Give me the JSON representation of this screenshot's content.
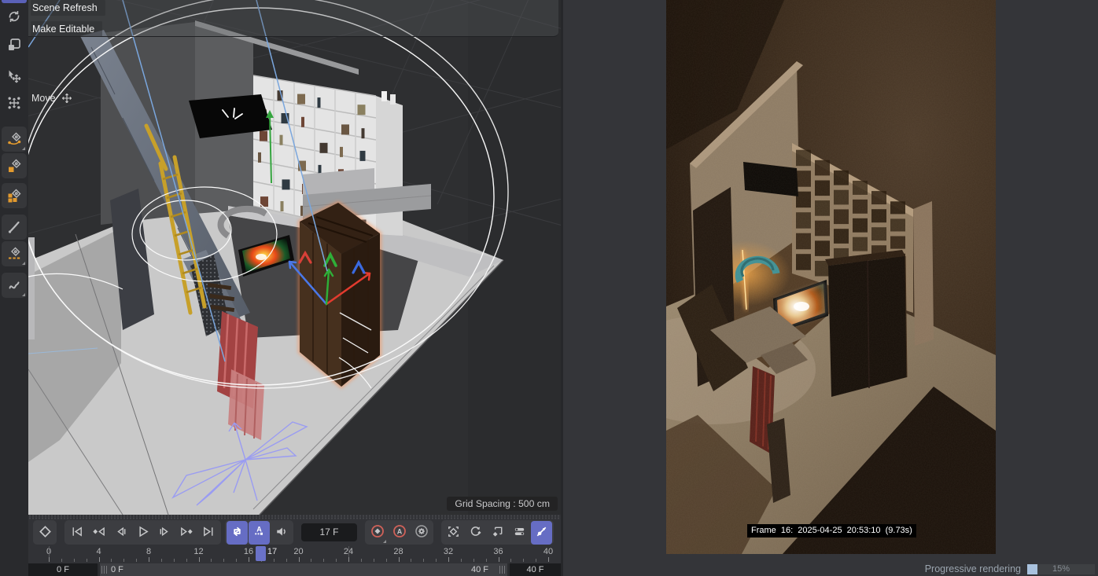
{
  "context_menu": {
    "items": [
      {
        "label": "Scene Refresh"
      },
      {
        "label": "Make Editable"
      }
    ]
  },
  "viewport": {
    "tool_label": "Move",
    "grid_spacing_label": "Grid Spacing : 500 cm"
  },
  "left_toolbar": {
    "icons": [
      "refresh-icon",
      "make-editable-icon",
      "move-tool-icon",
      "transform-tool-icon",
      "spline-pen-icon",
      "spline-square-pen-icon",
      "spline-cubes-icon",
      "brush-icon",
      "spline-dash-pen-icon",
      "freehand-spline-icon"
    ]
  },
  "timeline": {
    "current_frame_label": "17 F",
    "playhead_frame": 17,
    "playhead_label": "17",
    "frame_start": 0,
    "frame_end": 40,
    "ruler_labels": [
      {
        "frame": 0,
        "label": "0"
      },
      {
        "frame": 4,
        "label": "4"
      },
      {
        "frame": 8,
        "label": "8"
      },
      {
        "frame": 12,
        "label": "12"
      },
      {
        "frame": 16,
        "label": "16"
      },
      {
        "frame": 20,
        "label": "20"
      },
      {
        "frame": 24,
        "label": "24"
      },
      {
        "frame": 28,
        "label": "28"
      },
      {
        "frame": 32,
        "label": "32"
      },
      {
        "frame": 36,
        "label": "36"
      },
      {
        "frame": 40,
        "label": "40"
      }
    ],
    "guide_frames": [
      0,
      24
    ],
    "range_start_value": "0 F",
    "range_end_value": "40 F",
    "slider_start_label": "0 F",
    "slider_end_label": "40 F",
    "transport_icons": [
      "keyframe-diamond-icon",
      "go-start-icon",
      "prev-key-icon",
      "prev-frame-icon",
      "play-icon",
      "next-frame-icon",
      "next-key-icon",
      "go-end-icon",
      "loop-mode-icon",
      "keyframe-a-mode-icon",
      "sound-icon",
      "record-keyframe-icon",
      "autokey-icon",
      "keying-settings-icon",
      "record-position-icon",
      "record-rotation-icon",
      "record-scale-icon",
      "record-parameter-icon",
      "record-pla-icon"
    ],
    "active_toggles": [
      "loop-mode",
      "keyframe-a-mode",
      "record-pla"
    ]
  },
  "render_view": {
    "frame_info": "Frame  16:  2025-04-25  20:53:10  (9.73s)"
  },
  "status_bar": {
    "label": "Progressive rendering",
    "progress_percent_label": "15%",
    "progress_value": 15
  },
  "colors": {
    "accent_active": "#666dc4",
    "record_red": "#cf6159",
    "toolbar_orange": "#e29a2e",
    "progress_fill": "#a9c2de",
    "playhead": "#6a72c8"
  }
}
